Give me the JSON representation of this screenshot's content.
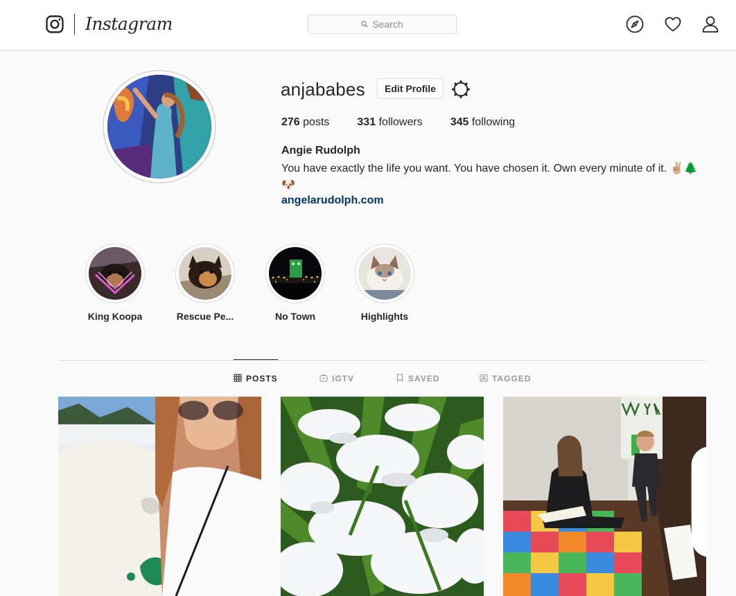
{
  "nav": {
    "logo_text": "Instagram",
    "search_placeholder": "Search",
    "icons": [
      "instagram-glyph-icon",
      "search-icon",
      "compass-icon",
      "heart-icon",
      "person-icon"
    ]
  },
  "profile": {
    "username": "anjababes",
    "edit_profile_label": "Edit Profile",
    "stats": {
      "posts_count": "276",
      "posts_label": "posts",
      "followers_count": "331",
      "followers_label": "followers",
      "following_count": "345",
      "following_label": "following"
    },
    "full_name": "Angie Rudolph",
    "bio": "You have exactly the life you want. You have chosen it. Own every minute of it. ✌🏼🌲",
    "bio_line2": "🐶",
    "website": "angelarudolph.com"
  },
  "highlights": [
    {
      "label": "King Koopa"
    },
    {
      "label": "Rescue Pe..."
    },
    {
      "label": "No Town"
    },
    {
      "label": "Highlights"
    }
  ],
  "tabs": [
    {
      "label": "POSTS",
      "icon": "grid-icon",
      "active": true
    },
    {
      "label": "IGTV",
      "icon": "igtv-icon",
      "active": false
    },
    {
      "label": "SAVED",
      "icon": "bookmark-icon",
      "active": false
    },
    {
      "label": "TAGGED",
      "icon": "tag-portrait-icon",
      "active": false
    }
  ],
  "posts": [
    {
      "kind": "photo",
      "description_icon": "image"
    },
    {
      "kind": "photo",
      "description_icon": "image"
    },
    {
      "kind": "video",
      "description_icon": "video-camera-icon"
    }
  ],
  "colors": {
    "link": "#003569",
    "border": "#dbdbdb",
    "text": "#262626",
    "muted": "#999999",
    "background": "#fafafa"
  }
}
